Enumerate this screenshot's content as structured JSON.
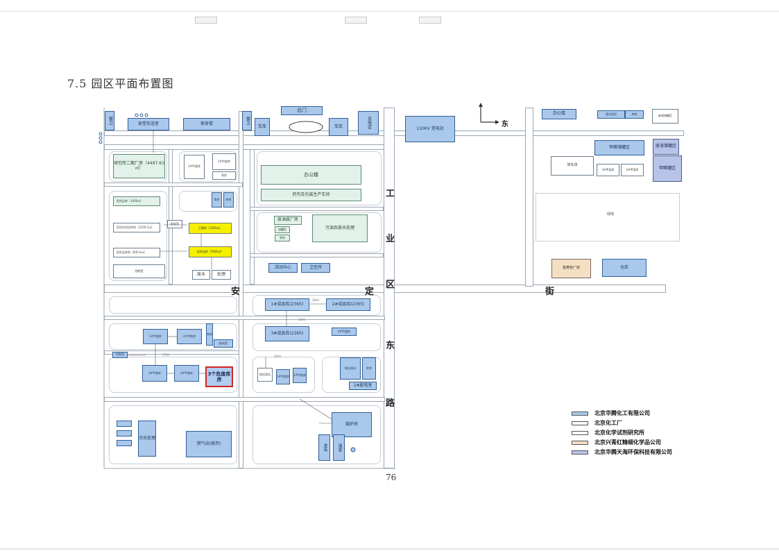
{
  "page": {
    "heading": "7.5 园区平面布置图",
    "page_number": "76"
  },
  "compass": {
    "east": "东"
  },
  "roads": {
    "gongye_1": "工",
    "gongye_2": "业",
    "gongye_3": "区",
    "anding_1": "安",
    "anding_2": "定",
    "anding_3": "街",
    "dong": "东",
    "lu": "路"
  },
  "buildings": {
    "jingwei_1": "警卫",
    "jingwei_2": "警卫",
    "canteen": "食堂及浴室",
    "dorm": "宿舍楼",
    "garage_1": "车库",
    "garage_2": "车库",
    "north_gate": "北门",
    "transformer_1": "变电室",
    "substation_110": "110KV 变电站",
    "research_plant": "研究所二期厂房（4497.63㎡）",
    "office_green": "办公楼",
    "workshop_green": "药剂及包装生产车间",
    "waste_plant": "废油废厂房",
    "waste_water_green": "污油及废水处理",
    "green_small_1": "油罐区",
    "green_small_2": "泵房",
    "activity_center": "活动中心",
    "clinic": "卫生所",
    "sewage_small": "废水",
    "sewage_small_2": "处理",
    "warehouse_1": "1#成品库(2365)",
    "warehouse_2": "2#成品库(2365)",
    "warehouse_3": "3#成品库(2365)",
    "hazard_store": "3个危废库房",
    "distribution_2": "2#配电室",
    "boiler": "锅炉房",
    "canteen_small": "食库",
    "bath_small": "澡堂",
    "sewage_big": "污水处理",
    "gas_station": "燃气站(废弃)",
    "office_east": "办公楼",
    "parking_east": "停车场",
    "nail_storage_1": "甲醛储罐区",
    "nail_storage_2": "甲醛罐区",
    "nail_purple": "废液储罐区",
    "vacant": "绿地",
    "tan_plant": "金黄色厂房",
    "blue_store": "仓库",
    "lab_small_1": "理化测试",
    "lab_small_2": "库房",
    "yellow_1": "乙醇库（2500㎡）",
    "yellow_2": "危险品库（5000㎡）",
    "row_1": "危险品库（1400㎡）",
    "row_2": "危险车间及库房（1200.1㎡）",
    "row_3": "危险品库房（830.0㎡）",
    "pump_1": "泵房",
    "pump_2": "库房",
    "dist_25m": "25m",
    "dist_22m": "22m",
    "dist_17m": "17m",
    "dist_10m": "10m",
    "store_small_a": "1#甲类库",
    "store_small_b": "2#甲类库",
    "store_small_c": "3#甲类库",
    "store_small_d": "4#甲类库",
    "control_room": "控制室",
    "distribution_1": "配电室"
  },
  "legend": [
    {
      "label": "北京华腾化工有限公司",
      "color": "#a9c8ec"
    },
    {
      "label": "北京化工厂",
      "color": "#ffffff"
    },
    {
      "label": "北京化学试剂研究所",
      "color": "#ffffff"
    },
    {
      "label": "北京兴青红精细化学品公司",
      "color": "#f5dfc3"
    },
    {
      "label": "北京华腾天海环保科技有限公司",
      "color": "#b7c4e8"
    }
  ],
  "icons": [
    "arrow-north-icon",
    "arrow-east-icon",
    "hydrant-icon"
  ]
}
